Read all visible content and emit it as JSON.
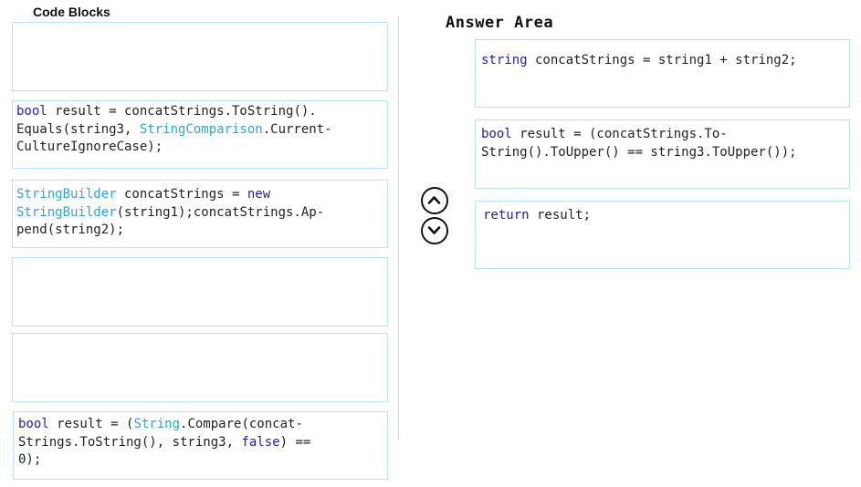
{
  "code_blocks": {
    "heading": "Code Blocks",
    "block_a": {
      "l1_kw": "bool",
      "l1_rest": " result = concatStrings.ToString().",
      "l2_a": "Equals(string3, ",
      "l2_type": "StringComparison",
      "l2_b": ".Current-",
      "l3": "CultureIgnoreCase);"
    },
    "block_b": {
      "l1_type": "StringBuilder",
      "l1_rest": " concatStrings = ",
      "l1_kw": "new",
      "l2_type": "StringBuilder",
      "l2_rest": "(string1);concatStrings.Ap-",
      "l3": "pend(string2);"
    },
    "block_c": {
      "l1_kw": "bool",
      "l1_a": " result = (",
      "l1_type": "String",
      "l1_b": ".Compare(concat-",
      "l2_a": "Strings.ToString(), string3, ",
      "l2_kw": "false",
      "l2_b": ") ==",
      "l3": "0);"
    }
  },
  "answer_area": {
    "heading": "Answer Area",
    "block_1": {
      "l1_type": "string",
      "l1_rest": " concatStrings = string1 + string2;"
    },
    "block_2": {
      "l1_kw": "bool",
      "l1_rest": " result = (concatStrings.To-",
      "l2": "String().ToUpper() == string3.ToUpper());"
    },
    "block_3": {
      "l1_kw": "return",
      "l1_rest": " result;"
    }
  },
  "controls": {
    "move_up_icon": "chevron-up-circle",
    "move_down_icon": "chevron-down-circle"
  },
  "colors": {
    "keyword": "#1f1fa8",
    "type": "#2fa8c8",
    "box_border": "#bfe3ec"
  }
}
